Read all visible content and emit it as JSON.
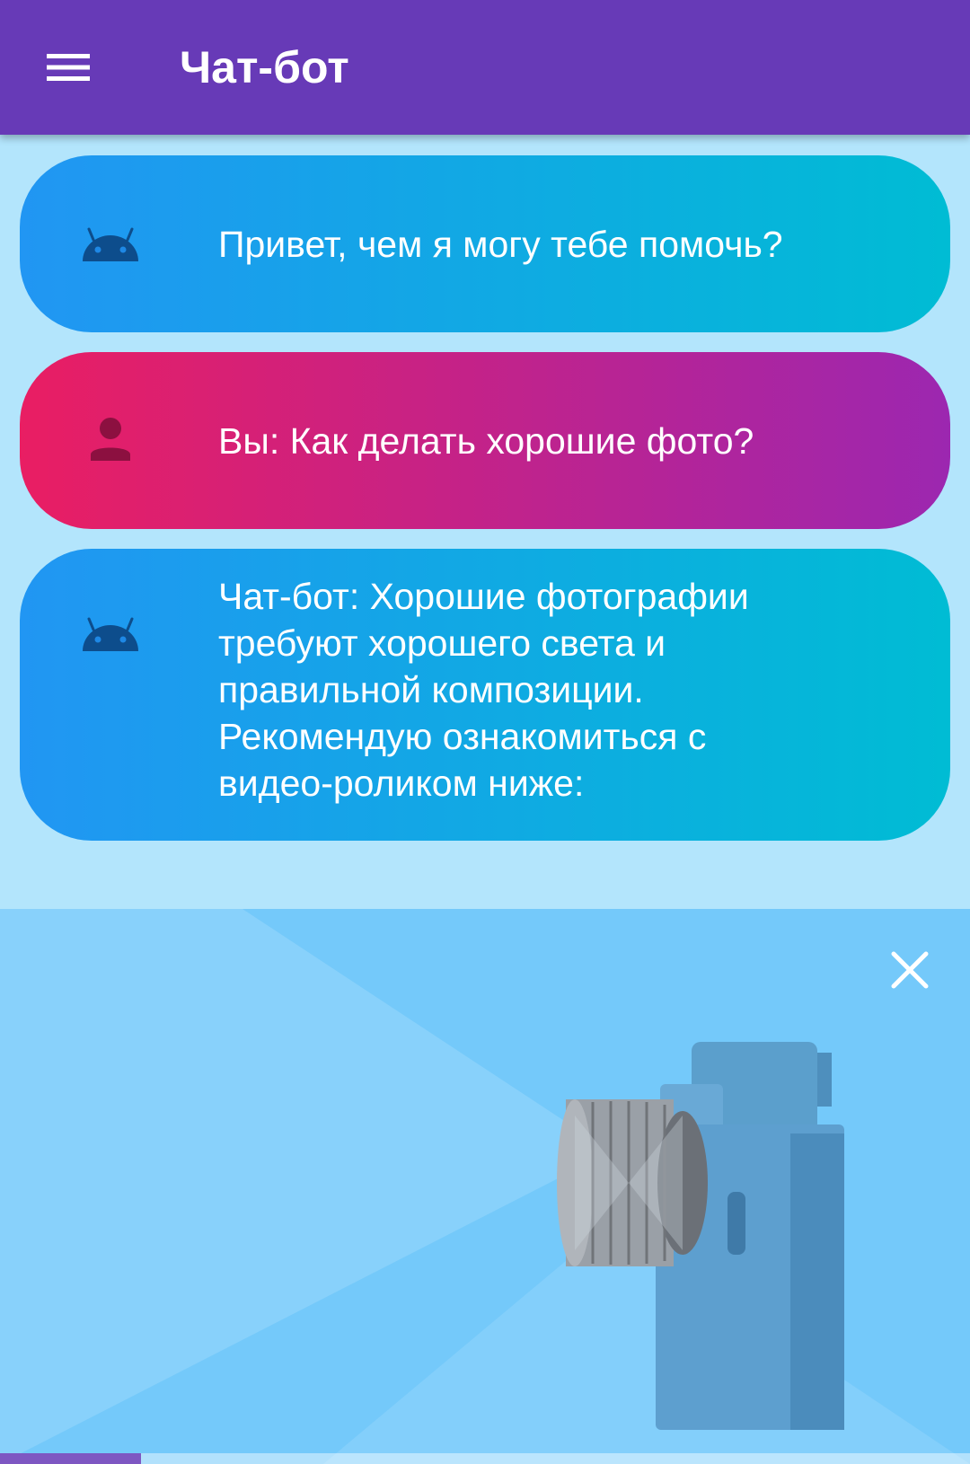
{
  "app_bar": {
    "title": "Чат-бот",
    "menu_icon": "hamburger-menu-icon",
    "background_color": "#673ab7"
  },
  "messages": [
    {
      "sender": "bot",
      "icon": "android-icon",
      "text": "Привет, чем я могу тебе помочь?"
    },
    {
      "sender": "user",
      "icon": "person-icon",
      "text": "Вы: Как делать хорошие фото?"
    },
    {
      "sender": "bot",
      "icon": "android-icon",
      "lines": [
        "Чат-бот: Хорошие фотографии",
        "требуют хорошего света и",
        "правильной композиции.",
        "Рекомендую ознакомиться с",
        "видео-роликом ниже:"
      ]
    }
  ],
  "video": {
    "subject": "camera",
    "close_icon": "close-icon",
    "progress": 0.145
  },
  "colors": {
    "page_background": "#b3e5fc",
    "bot_bubble_gradient": [
      "#2196f3",
      "#00bcd4"
    ],
    "user_bubble_gradient": [
      "#e91e63",
      "#9c27b0"
    ],
    "bot_icon": "#0d4d8c",
    "user_icon": "#8c1040",
    "video_background": "#74c9fa"
  }
}
